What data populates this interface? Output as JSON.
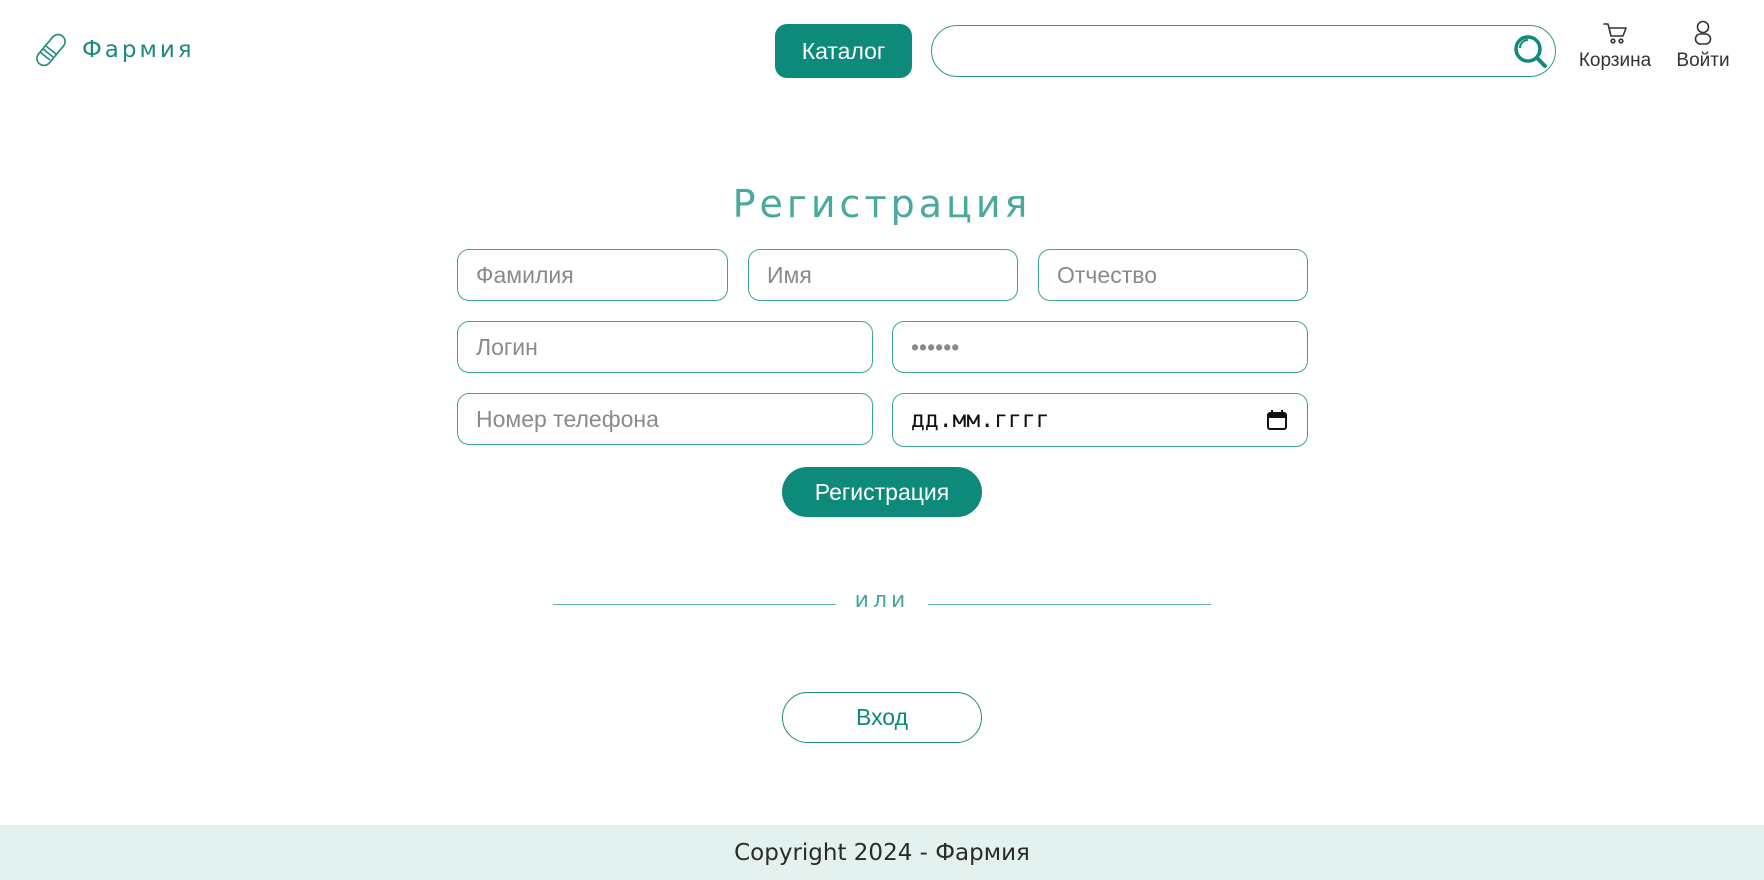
{
  "header": {
    "logo_text": "Фармия",
    "catalog_label": "Каталог",
    "search": {
      "value": "",
      "placeholder": ""
    },
    "cart_label": "Корзина",
    "login_label": "Войти"
  },
  "form": {
    "title": "Регистрация",
    "fields": {
      "lastname_placeholder": "Фамилия",
      "firstname_placeholder": "Имя",
      "middlename_placeholder": "Отчество",
      "login_placeholder": "Логин",
      "password_placeholder": "••••••",
      "phone_placeholder": "Номер телефона",
      "date_placeholder": "дд.мм.гггг"
    },
    "register_label": "Регистрация",
    "divider_text": "или",
    "login_button_label": "Вход"
  },
  "footer": {
    "copyright": "Copyright 2024 - Фармия"
  },
  "colors": {
    "accent": "#0e8a7b",
    "accent_light": "#4aa89c",
    "footer_bg": "#e3f1ef"
  },
  "icons": [
    "pill-logo-icon",
    "search-icon",
    "cart-icon",
    "user-icon",
    "calendar-icon"
  ]
}
